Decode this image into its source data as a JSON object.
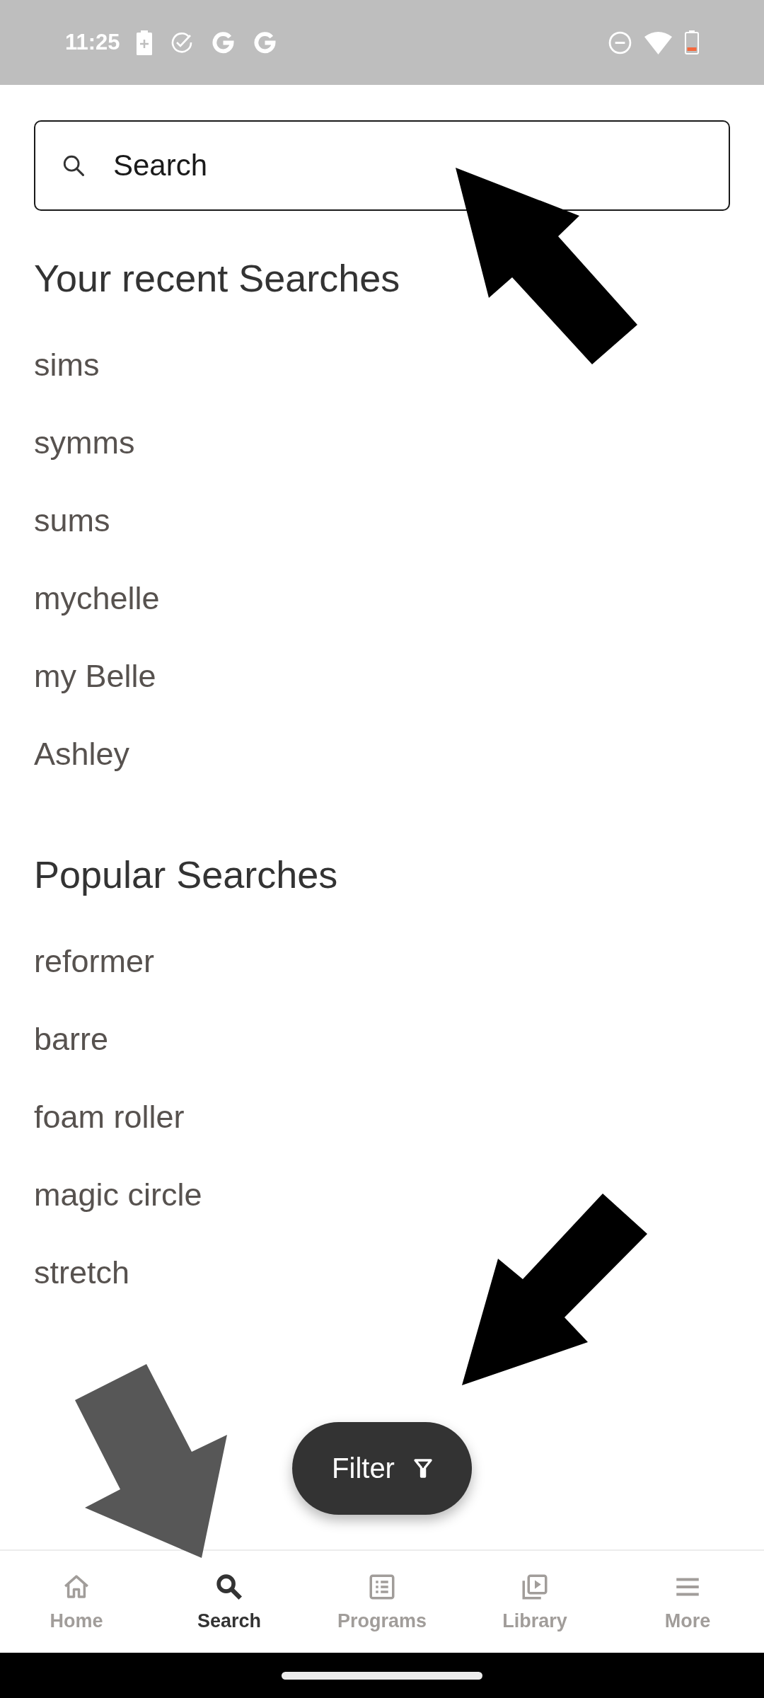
{
  "status_bar": {
    "time": "11:25"
  },
  "search": {
    "placeholder": "Search"
  },
  "sections": [
    {
      "title": "Your recent Searches",
      "items": [
        "sims",
        "symms",
        "sums",
        "mychelle",
        "my Belle",
        "Ashley"
      ]
    },
    {
      "title": "Popular Searches",
      "items": [
        "reformer",
        "barre",
        "foam roller",
        "magic circle",
        "stretch"
      ]
    }
  ],
  "filter_button": {
    "label": "Filter"
  },
  "bottom_nav": [
    {
      "kind": "home",
      "label": "Home",
      "selected": false
    },
    {
      "kind": "search",
      "label": "Search",
      "selected": true
    },
    {
      "kind": "programs",
      "label": "Programs",
      "selected": false
    },
    {
      "kind": "library",
      "label": "Library",
      "selected": false
    },
    {
      "kind": "more",
      "label": "More",
      "selected": false
    }
  ]
}
